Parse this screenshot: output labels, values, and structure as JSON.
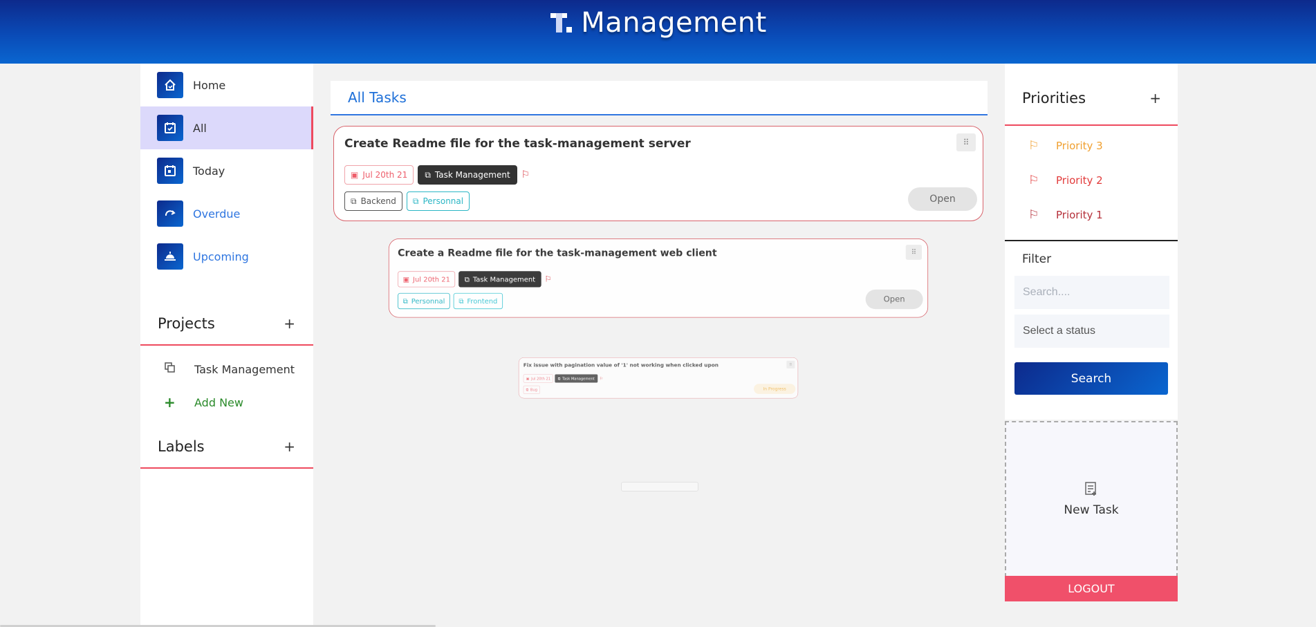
{
  "header": {
    "title": "Management"
  },
  "sidebar": {
    "nav": [
      {
        "label": "Home",
        "icon": "home-icon"
      },
      {
        "label": "All",
        "icon": "calendar-check-icon"
      },
      {
        "label": "Today",
        "icon": "calendar-day-icon"
      },
      {
        "label": "Overdue",
        "icon": "redo-icon"
      },
      {
        "label": "Upcoming",
        "icon": "sunrise-icon"
      }
    ],
    "projects": {
      "title": "Projects",
      "add": "+",
      "items": [
        "Task Management"
      ],
      "add_new": "Add New"
    },
    "labels": {
      "title": "Labels",
      "add": "+"
    }
  },
  "main": {
    "tab": "All Tasks",
    "tasks": [
      {
        "title": "Create Readme file for the task-management server",
        "date": "Jul 20th 21",
        "project": "Task Management",
        "labels": [
          "Backend",
          "Personnal"
        ],
        "status": "Open",
        "handle": "⠿"
      },
      {
        "title": "Create a Readme file for the task-management web client",
        "date": "Jul 20th 21",
        "project": "Task Management",
        "labels": [
          "Personnal",
          "Frontend"
        ],
        "status": "Open",
        "handle": "⠿"
      },
      {
        "title": "Fix issue with pagination value of '1' not working when clicked upon",
        "date": "Jul 20th 21",
        "project": "Task Management",
        "labels": [
          "Bug"
        ],
        "status": "In Progress",
        "handle": "⠿"
      }
    ]
  },
  "right": {
    "priorities": {
      "title": "Priorities",
      "add": "+",
      "items": [
        {
          "label": "Priority 3",
          "color": "#f0a030"
        },
        {
          "label": "Priority 2",
          "color": "#e23b3b"
        },
        {
          "label": "Priority 1",
          "color": "#b5303a"
        }
      ]
    },
    "filter": {
      "title": "Filter",
      "search_placeholder": "Search....",
      "status_placeholder": "Select a status",
      "search_button": "Search"
    },
    "new_task": "New Task",
    "logout": "LOGOUT"
  }
}
